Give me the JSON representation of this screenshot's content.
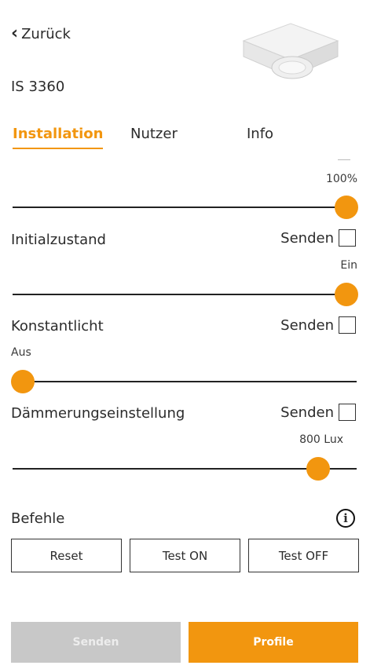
{
  "header": {
    "back_label": "Zurück",
    "device_name": "IS 3360"
  },
  "tabs": [
    {
      "label": "Installation",
      "active": true
    },
    {
      "label": "Nutzer",
      "active": false
    },
    {
      "label": "Info",
      "active": false
    }
  ],
  "settings": {
    "brightness": {
      "value_label": "100%",
      "fraction": 1.0
    },
    "initialzustand": {
      "label": "Initialzustand",
      "send_label": "Senden",
      "value_label": "Ein",
      "fraction": 1.0
    },
    "konstantlicht": {
      "label": "Konstantlicht",
      "send_label": "Senden",
      "value_label": "Aus",
      "fraction": 0.0
    },
    "daemmerung": {
      "label": "Dämmerungseinstellung",
      "send_label": "Senden",
      "value_label": "800 Lux",
      "fraction": 0.9
    }
  },
  "commands": {
    "title": "Befehle",
    "info_glyph": "i",
    "buttons": [
      {
        "label": "Reset"
      },
      {
        "label": "Test ON"
      },
      {
        "label": "Test OFF"
      }
    ]
  },
  "footer": {
    "send_label": "Senden",
    "profile_label": "Profile"
  },
  "colors": {
    "accent": "#f2960f",
    "disabled": "#c8c8c8"
  }
}
